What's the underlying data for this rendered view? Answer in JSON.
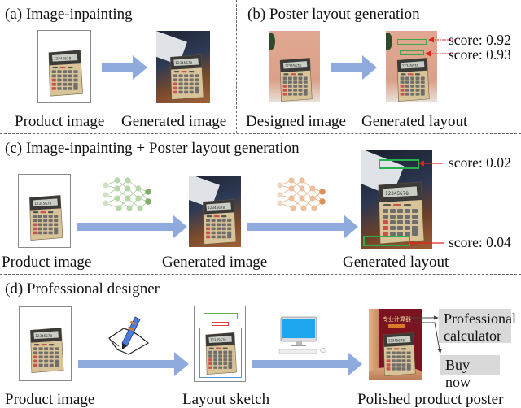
{
  "panels": {
    "a": {
      "title": "(a) Image-inpainting",
      "captions": [
        "Product image",
        "Generated image"
      ]
    },
    "b": {
      "title": "(b) Poster layout generation",
      "captions": [
        "Designed image",
        "Generated layout"
      ],
      "scores": [
        "score: 0.92",
        "score: 0.93"
      ]
    },
    "c": {
      "title": "(c)  Image-inpainting + Poster layout generation",
      "captions": [
        "Product image",
        "Generated image",
        "Generated layout"
      ],
      "scores": [
        "score: 0.02",
        "score: 0.04"
      ]
    },
    "d": {
      "title": "(d) Professional designer",
      "captions": [
        "Product image",
        "Layout sketch",
        "Polished product poster"
      ],
      "poster_labels": [
        "Professional calculator",
        "Buy now"
      ],
      "poster_text_cn": "专业计算器"
    }
  },
  "icons": {
    "arrow": "right-arrow",
    "network_green": "neural-network-icon",
    "network_orange": "neural-network-icon",
    "pen": "pen-writing-icon",
    "computer": "desktop-computer-icon"
  },
  "colors": {
    "arrow": "#8fabdd",
    "layout_box": "#3aa84a",
    "pointer": "#e0261c",
    "net_green": "#7fae6a",
    "net_orange": "#d9925a",
    "label_bg": "#d9d9d9"
  }
}
